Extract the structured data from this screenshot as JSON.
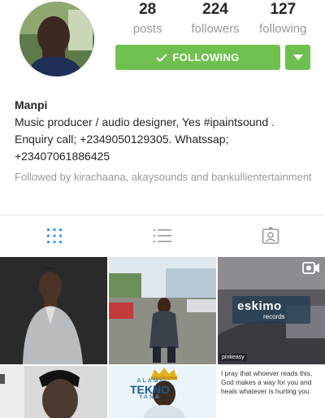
{
  "profile": {
    "stats": [
      {
        "value": "28",
        "label": "posts"
      },
      {
        "value": "224",
        "label": "followers"
      },
      {
        "value": "127",
        "label": "following"
      }
    ],
    "follow_button_label": "FOLLOWING",
    "name": "Manpi",
    "bio_lines": [
      "Music producer / audio designer, Yes #ipaintsound .",
      "Enquiry call; +2349050129305. Whatssap;",
      "+23407061886425"
    ],
    "followed_by": "Followed by kirachaana, akaysounds and bankullientertainment"
  },
  "tabs": [
    {
      "icon": "grid-icon",
      "active": true
    },
    {
      "icon": "list-icon",
      "active": false
    },
    {
      "icon": "tagged-icon",
      "active": false
    }
  ],
  "posts": {
    "eskimo_brand": "eskimo",
    "eskimo_sub": "records",
    "repost_credit": "pinkeasy",
    "album_small": "ALAMI",
    "album_title": "TEKNO",
    "album_sub": "YANA",
    "quote": "I pray that whoever reads this, God makes a way for you and heals whatever is hurting you."
  },
  "colors": {
    "accent_green": "#70c050",
    "active_tab_blue": "#3897f0",
    "muted_text": "#999999"
  }
}
